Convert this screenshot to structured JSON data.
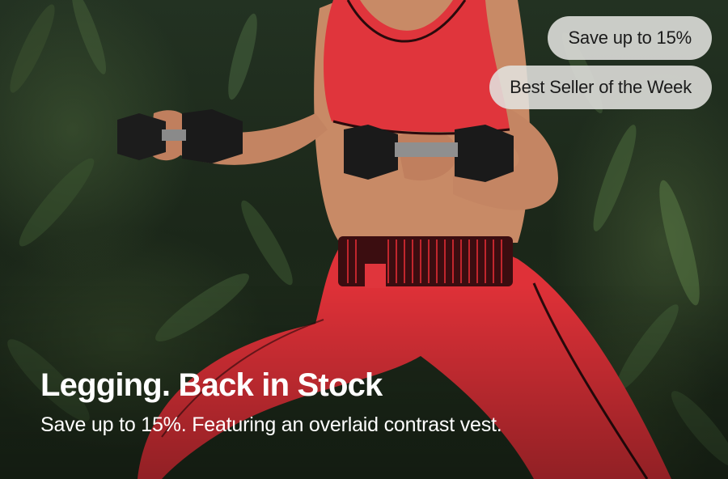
{
  "badges": [
    {
      "label": "Save up to 15%"
    },
    {
      "label": "Best Seller of the Week"
    }
  ],
  "hero": {
    "title": "Legging. Back in Stock",
    "subtitle": "Save up to 15%. Featuring an overlaid contrast vest."
  },
  "colors": {
    "garment_red": "#e0353c",
    "foliage_dark": "#1e2b1b",
    "badge_bg": "#e1e1de",
    "text_white": "#ffffff"
  }
}
